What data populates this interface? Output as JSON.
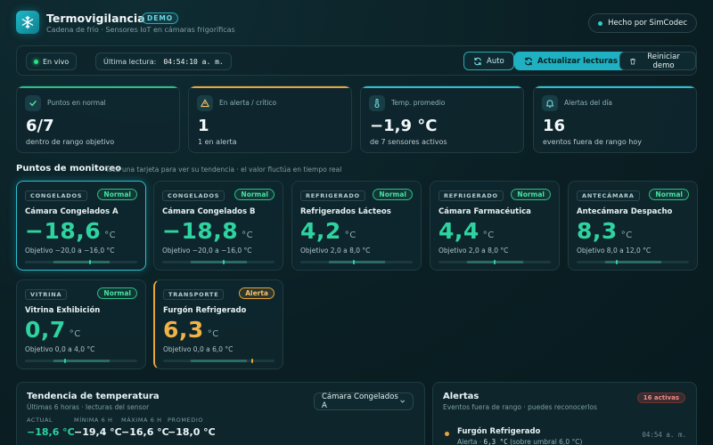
{
  "header": {
    "title": "Termovigilancia",
    "badge": "DEMO",
    "subtitle": "Cadena de frío · Sensores IoT en cámaras frigoríficas",
    "made_by": "Hecho por SimCodec"
  },
  "toolbar": {
    "live_label": "En vivo",
    "last_read_label": "Última lectura:",
    "last_read_value": "04:54:10 a. m.",
    "auto_label": "Auto",
    "refresh_label": "Actualizar lecturas",
    "reset_label": "Reiniciar demo"
  },
  "kpis": [
    {
      "label": "Puntos en normal",
      "value": "6/7",
      "sub": "dentro de rango objetivo",
      "accent": "#2bbf84",
      "icon": "check-icon"
    },
    {
      "label": "En alerta / crítico",
      "value": "1",
      "sub": "1 en alerta",
      "accent": "#e8a53a",
      "icon": "warning-icon"
    },
    {
      "label": "Temp. promedio",
      "value": "−1,9 °C",
      "sub": "de 7 sensores activos",
      "accent": "#2bc0cf",
      "icon": "thermometer-icon"
    },
    {
      "label": "Alertas del día",
      "value": "16",
      "sub": "eventos fuera de rango hoy",
      "accent": "#2bc0cf",
      "icon": "bell-icon"
    }
  ],
  "monitoring": {
    "title": "Puntos de monitoreo",
    "hint": "Toca una tarjeta para ver su tendencia · el valor fluctúa en tiempo real",
    "unit": "°C",
    "cards": [
      {
        "tag": "CONGELADOS",
        "status": "Normal",
        "name": "Cámara Congelados A",
        "temp": "−18,6",
        "range": "Objetivo −20,0 a −16,0 °C",
        "level": 0.58
      },
      {
        "tag": "CONGELADOS",
        "status": "Normal",
        "name": "Cámara Congelados B",
        "temp": "−18,8",
        "range": "Objetivo −20,0 a −16,0 °C",
        "level": 0.55
      },
      {
        "tag": "REFRIGERADO",
        "status": "Normal",
        "name": "Refrigerados Lácteos",
        "temp": "4,2",
        "range": "Objetivo 2,0 a 8,0 °C",
        "level": 0.48
      },
      {
        "tag": "REFRIGERADO",
        "status": "Normal",
        "name": "Cámara Farmacéutica",
        "temp": "4,4",
        "range": "Objetivo 2,0 a 8,0 °C",
        "level": 0.5
      },
      {
        "tag": "ANTECÁMARA",
        "status": "Normal",
        "name": "Antecámara Despacho",
        "temp": "8,3",
        "range": "Objetivo 8,0 a 12,0 °C",
        "level": 0.36
      },
      {
        "tag": "VITRINA",
        "status": "Normal",
        "name": "Vitrina Exhibición",
        "temp": "0,7",
        "range": "Objetivo 0,0 a 4,0 °C",
        "level": 0.36
      },
      {
        "tag": "TRANSPORTE",
        "status": "Alerta",
        "name": "Furgón Refrigerado",
        "temp": "6,3",
        "range": "Objetivo 0,0 a 6,0 °C",
        "level": 0.8
      }
    ]
  },
  "trend": {
    "title": "Tendencia de temperatura",
    "subtitle": "Últimas 6 horas · lecturas del sensor",
    "selected": "Cámara Congelados A",
    "stats": [
      {
        "label": "ACTUAL",
        "value": "−18,6 °C"
      },
      {
        "label": "MÍNIMA 6 H",
        "value": "−19,4 °C"
      },
      {
        "label": "MÁXIMA 6 H",
        "value": "−16,6 °C"
      },
      {
        "label": "PROMEDIO",
        "value": "−18,0 °C"
      }
    ]
  },
  "alerts": {
    "title": "Alertas",
    "count": "16 activas",
    "subtitle": "Eventos fuera de rango · puedes reconocerlos",
    "items": [
      {
        "name": "Furgón Refrigerado",
        "detail_prefix": "Alerta ·",
        "detail_value": "6,3 °C",
        "detail_suffix": "(sobre umbral 6,0 °C)",
        "time": "04:54 a. m."
      }
    ]
  },
  "colors": {
    "accent": "#1fb1c1",
    "normal": "#2bbf84",
    "alert": "#e8a53a",
    "normal_temp": "#2fd3a0",
    "alert_temp": "#f0b347"
  }
}
